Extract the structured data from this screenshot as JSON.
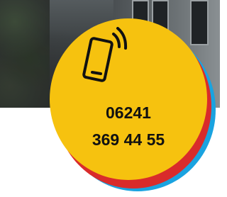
{
  "phone": {
    "line1": "06241",
    "line2": "369 44 55"
  },
  "icons": {
    "phone": "smartphone-ringing-icon"
  },
  "colors": {
    "primary_circle": "#f6c20f",
    "middle_circle": "#d92b2b",
    "back_circle": "#1aa3e0"
  }
}
